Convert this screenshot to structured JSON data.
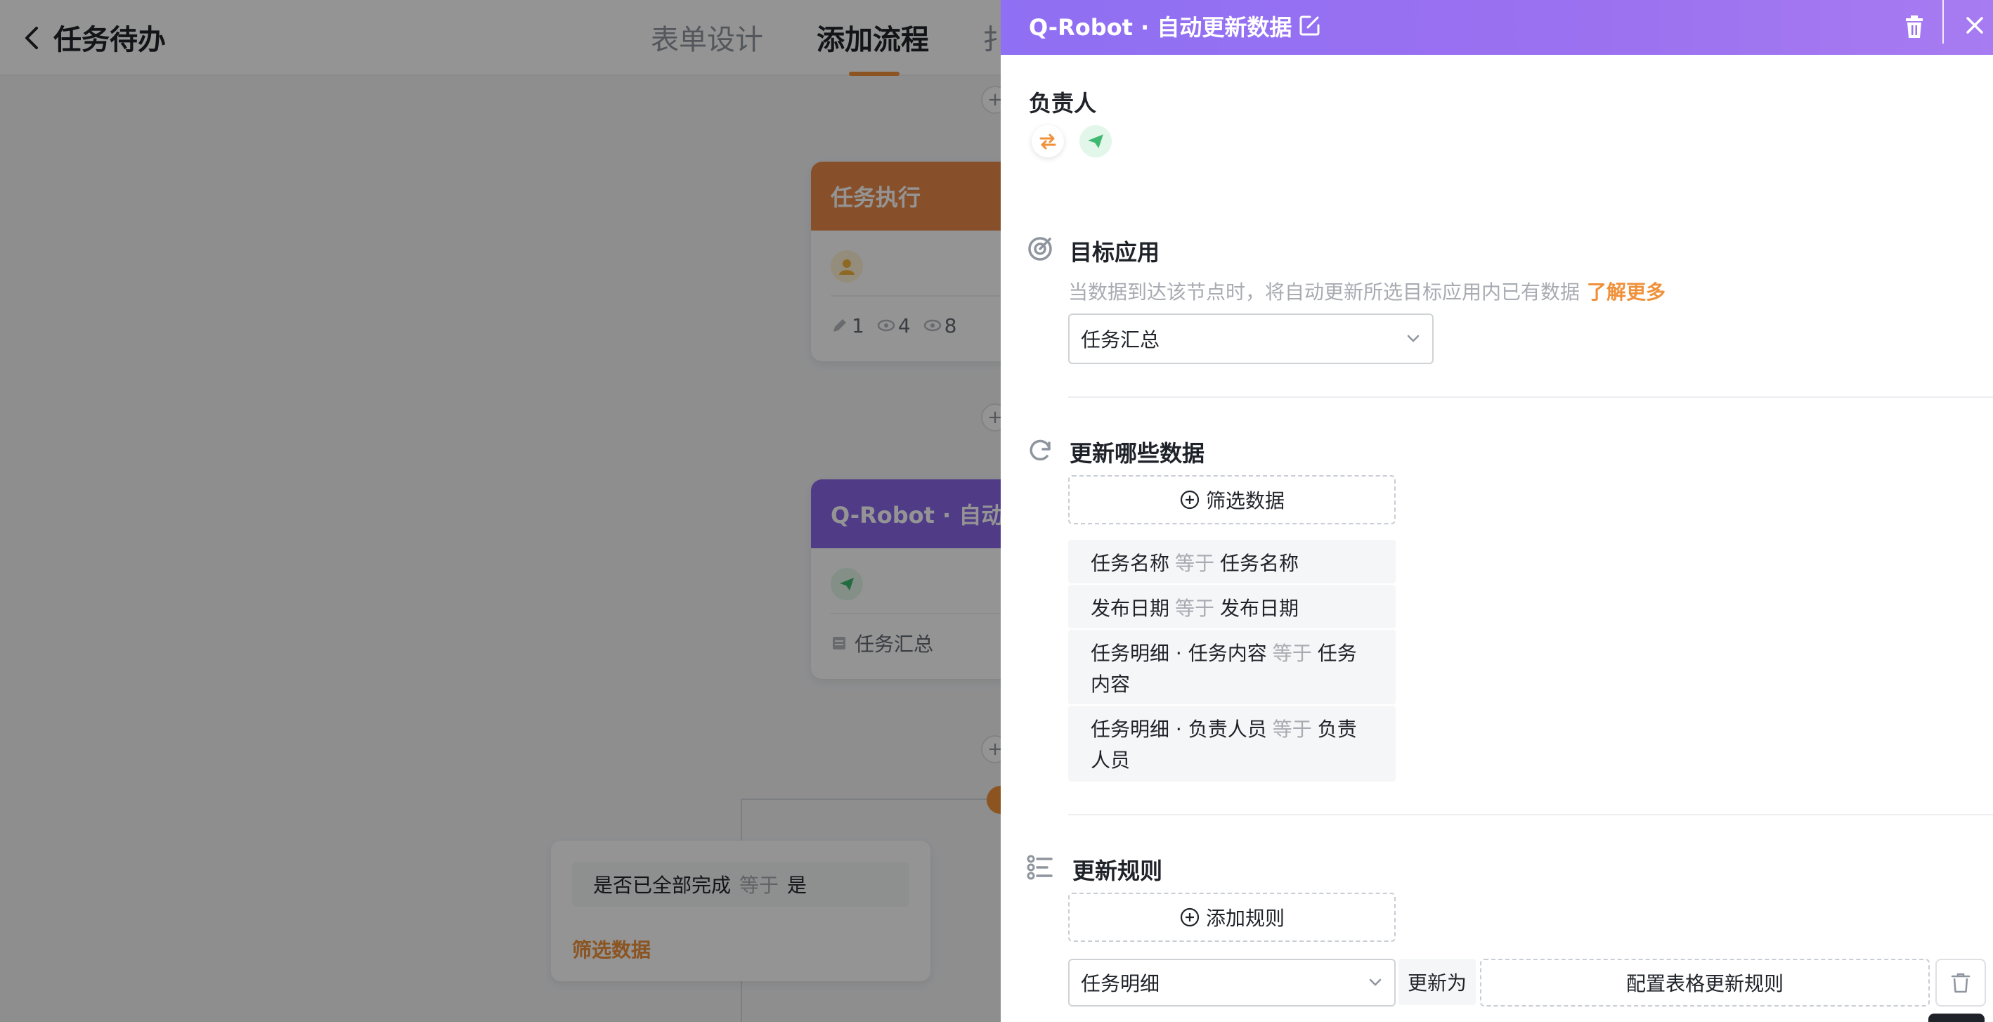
{
  "app": {
    "title": "任务待办",
    "tabs": [
      "表单设计",
      "添加流程",
      "扌"
    ]
  },
  "flow": {
    "task_node": {
      "title": "任务执行",
      "stats": [
        "1",
        "4",
        "8"
      ]
    },
    "robot_node": {
      "title": "Q-Robot · 自动更",
      "target_app": "任务汇总"
    },
    "branch": {
      "field": "是否已全部完成",
      "op": "等于",
      "value": "是",
      "filter_link": "筛选数据"
    }
  },
  "drawer": {
    "title": "Q-Robot · 自动更新数据",
    "owner_label": "负责人",
    "target_app": {
      "label": "目标应用",
      "desc": "当数据到达该节点时，将自动更新所选目标应用内已有数据",
      "learn_more": "了解更多",
      "selected": "任务汇总"
    },
    "which_data": {
      "label": "更新哪些数据",
      "filter_button": "筛选数据",
      "conditions": [
        {
          "field": "任务名称",
          "op": "等于",
          "value": "任务名称"
        },
        {
          "field": "发布日期",
          "op": "等于",
          "value": "发布日期"
        },
        {
          "field": "任务明细 · 任务内容",
          "op": "等于",
          "value": "任务内容"
        },
        {
          "field": "任务明细 · 负责人员",
          "op": "等于",
          "value": "负责人员"
        }
      ]
    },
    "rules": {
      "label": "更新规则",
      "add_button": "添加规则",
      "row": {
        "field": "任务明细",
        "update_to": "更新为",
        "config": "配置表格更新规则"
      }
    }
  },
  "colors": {
    "accent": "#f0913a",
    "header_purple": "#9b71f0",
    "task_node_orange": "#e98a4a",
    "robot_node_purple": "#8a67e8"
  }
}
